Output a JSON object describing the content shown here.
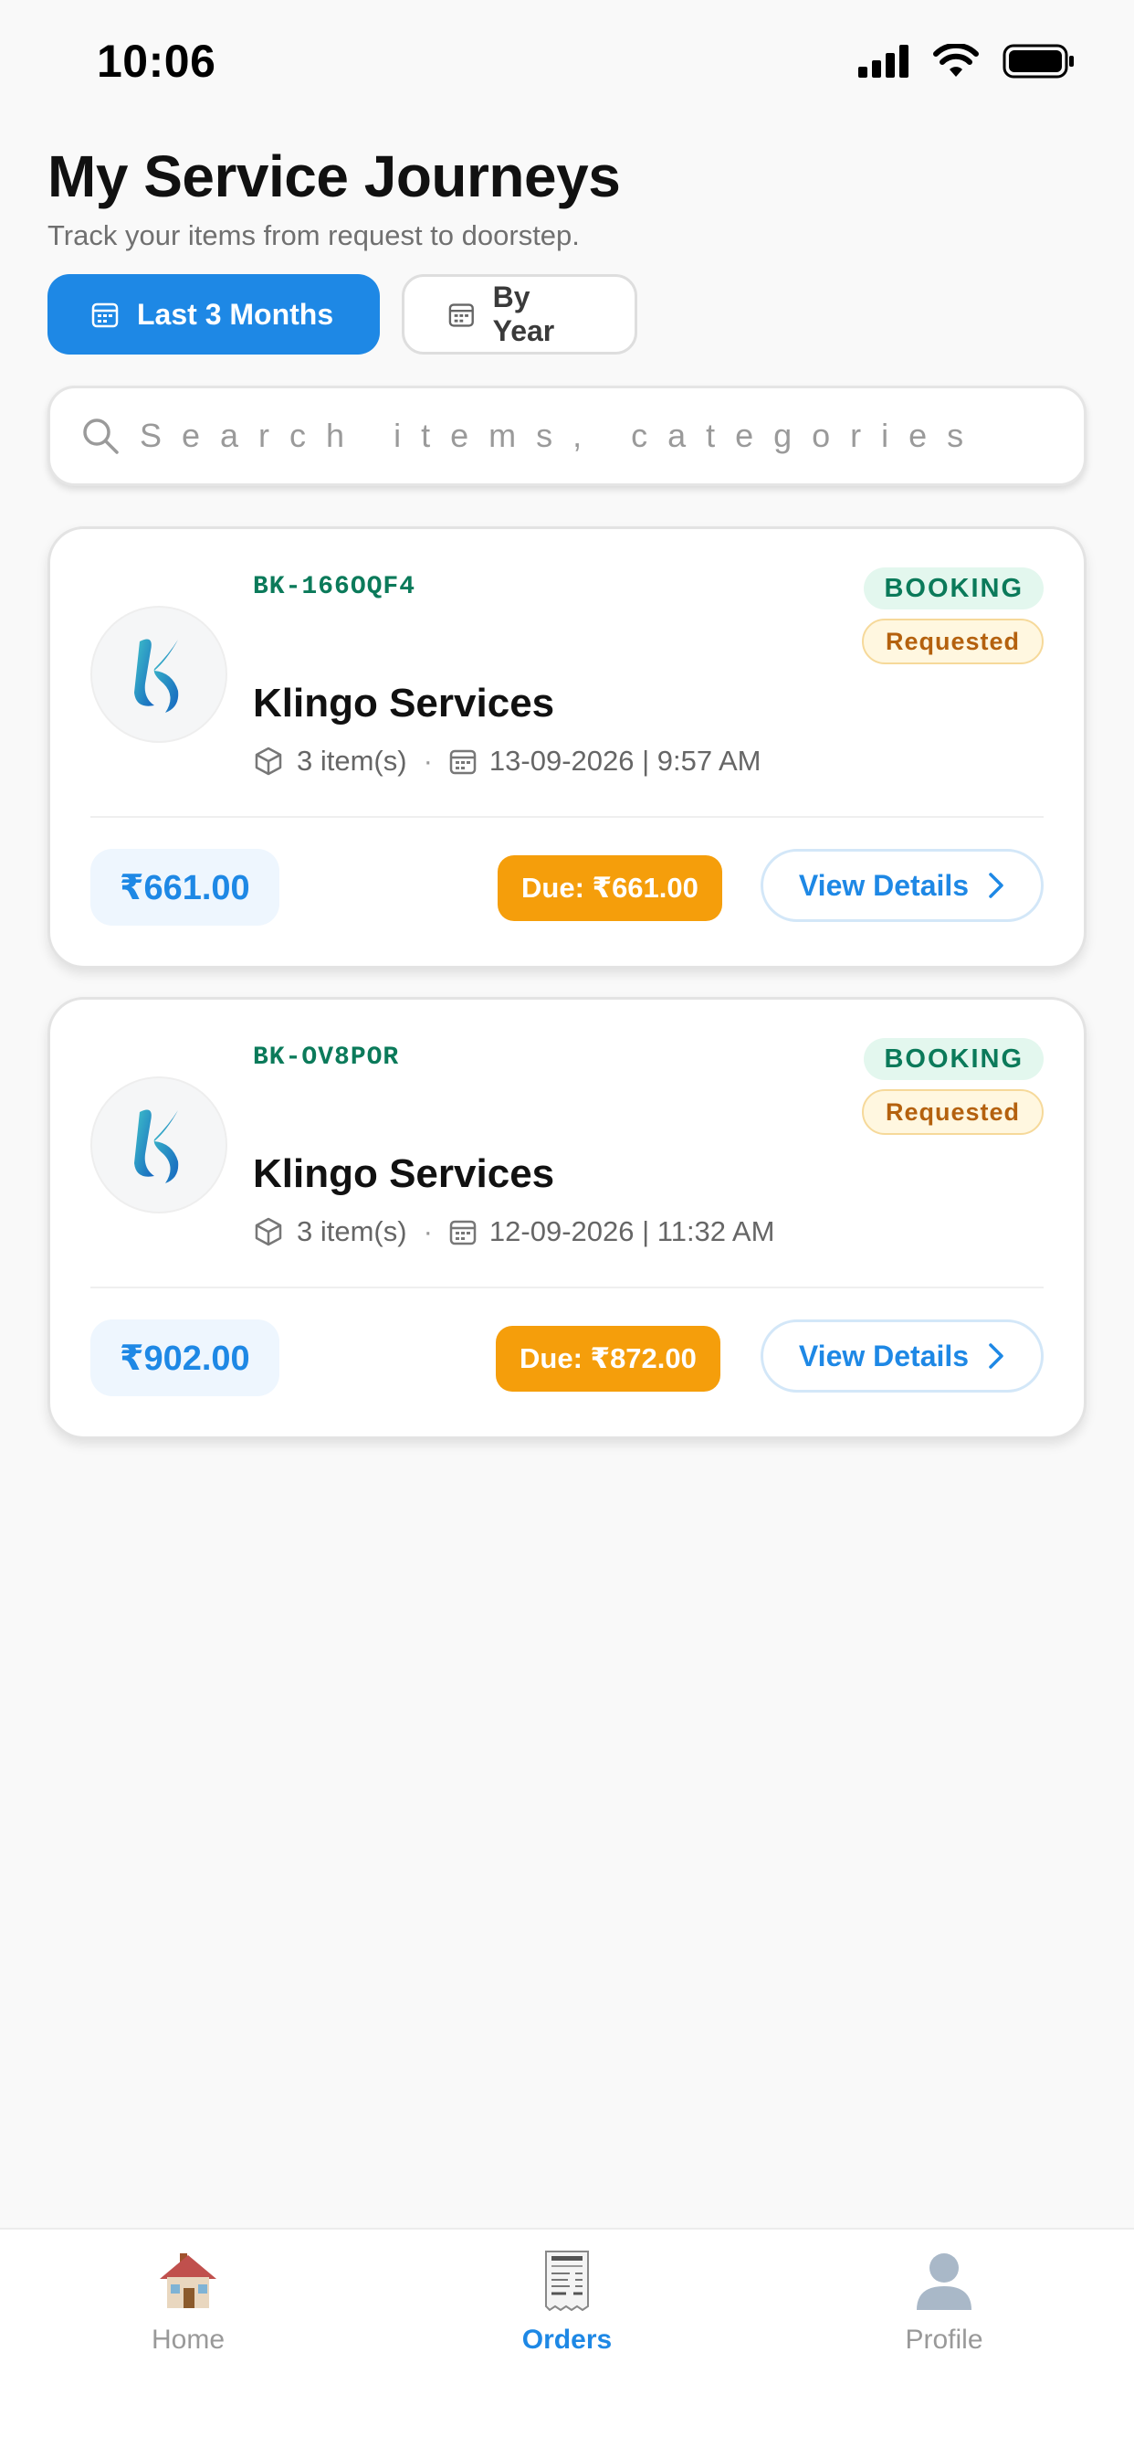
{
  "status_bar": {
    "time": "10:06"
  },
  "header": {
    "title": "My Service Journeys",
    "subtitle": "Track your items from request to doorstep."
  },
  "filters": {
    "active_label": "Last 3 Months",
    "inactive_label": "By Year"
  },
  "search": {
    "placeholder": "Search items, categories"
  },
  "orders": [
    {
      "booking_id": "BK-166OQF4",
      "type": "BOOKING",
      "status": "Requested",
      "service_name": "Klingo Services",
      "items": "3 item(s)",
      "separator": "·",
      "datetime": "13-09-2026 | 9:57 AM",
      "amount": "₹661.00",
      "due": "Due: ₹661.00",
      "action_label": "View Details"
    },
    {
      "booking_id": "BK-OV8POR",
      "type": "BOOKING",
      "status": "Requested",
      "service_name": "Klingo Services",
      "items": "3 item(s)",
      "separator": "·",
      "datetime": "12-09-2026 | 11:32 AM",
      "amount": "₹902.00",
      "due": "Due: ₹872.00",
      "action_label": "View Details"
    }
  ],
  "bottom_nav": {
    "items": [
      {
        "label": "Home",
        "icon": "house-icon"
      },
      {
        "label": "Orders",
        "icon": "receipt-icon",
        "active": true
      },
      {
        "label": "Profile",
        "icon": "person-icon"
      }
    ]
  },
  "colors": {
    "accent": "#1e88e5",
    "booking_green": "#0b7a5a",
    "status_orange": "#b4610e",
    "due_amber": "#f59e0b"
  }
}
